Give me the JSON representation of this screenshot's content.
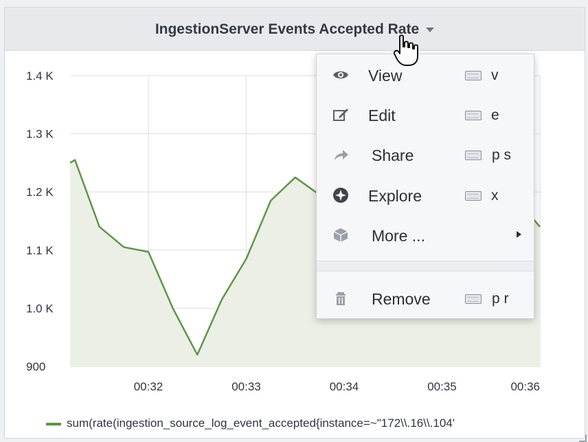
{
  "panel": {
    "title": "IngestionServer Events Accepted Rate"
  },
  "chart_data": {
    "type": "area",
    "title": "IngestionServer Events Accepted Rate",
    "xlabel": "",
    "ylabel": "",
    "y_tick_labels": [
      "1.4 K",
      "1.3 K",
      "1.2 K",
      "1.1 K",
      "1.0 K",
      "900"
    ],
    "y_tick_values": [
      1400,
      1300,
      1200,
      1100,
      1000,
      900
    ],
    "x_tick_labels": [
      "00:32",
      "00:33",
      "00:34",
      "00:35",
      "00:36"
    ],
    "x_tick_minutes": [
      32,
      33,
      34,
      35,
      36
    ],
    "ylim": [
      900,
      1400
    ],
    "xlim": [
      31.2,
      36.0
    ],
    "grid": true,
    "legend_position": "bottom-left",
    "series": [
      {
        "name": "sum(rate(ingestion_source_log_event_accepted{instance=~\"172\\\\.16\\\\.104'",
        "color": "#62934b",
        "x": [
          31.2,
          31.25,
          31.5,
          31.75,
          32.0,
          32.25,
          32.5,
          32.75,
          33.0,
          33.25,
          33.5,
          33.75,
          35.75,
          36.0
        ],
        "y": [
          1250,
          1255,
          1140,
          1105,
          1097,
          1000,
          920,
          1015,
          1085,
          1185,
          1225,
          1195,
          1190,
          1140
        ]
      }
    ]
  },
  "legend": {
    "label": "sum(rate(ingestion_source_log_event_accepted{instance=~\"172\\\\.16\\\\.104'"
  },
  "menu": {
    "items": [
      {
        "label": "View",
        "shortcut": "v",
        "icon": "eye-icon"
      },
      {
        "label": "Edit",
        "shortcut": "e",
        "icon": "edit-icon"
      },
      {
        "label": "Share",
        "shortcut": "p s",
        "icon": "share-icon"
      },
      {
        "label": "Explore",
        "shortcut": "x",
        "icon": "compass-icon"
      },
      {
        "label": "More ...",
        "shortcut": "",
        "icon": "cube-icon"
      },
      {
        "label": "Remove",
        "shortcut": "p r",
        "icon": "trash-icon"
      }
    ]
  },
  "colors": {
    "series_line": "#62934b",
    "series_fill": "#ecefe6",
    "grid": "#dadde2",
    "header_bg": "#e7e9ed",
    "menu_bg": "#f6f7f9"
  }
}
